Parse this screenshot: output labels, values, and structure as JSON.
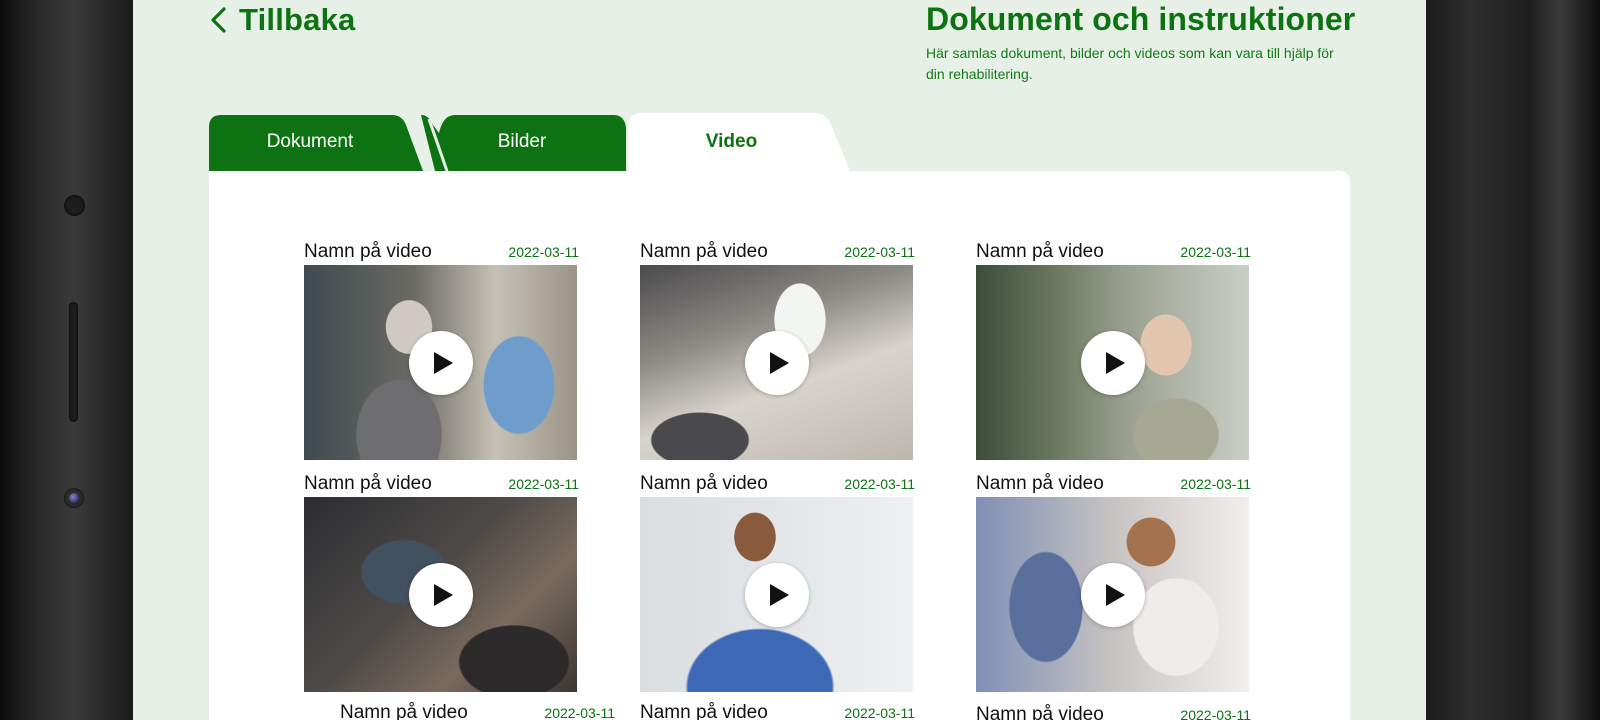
{
  "header": {
    "back_label": "Tillbaka",
    "title": "Dokument och instruktioner",
    "subtitle": "Här samlas dokument, bilder och videos som kan vara till hjälp för din rehabilitering."
  },
  "tabs": [
    {
      "label": "Dokument",
      "active": false
    },
    {
      "label": "Bilder",
      "active": false
    },
    {
      "label": "Video",
      "active": true
    }
  ],
  "videos": [
    {
      "name": "Namn på video",
      "date": "2022-03-11"
    },
    {
      "name": "Namn på video",
      "date": "2022-03-11"
    },
    {
      "name": "Namn på video",
      "date": "2022-03-11"
    },
    {
      "name": "Namn på video",
      "date": "2022-03-11"
    },
    {
      "name": "Namn på video",
      "date": "2022-03-11"
    },
    {
      "name": "Namn på video",
      "date": "2022-03-11"
    },
    {
      "name": "Namn på video",
      "date": "2022-03-11"
    },
    {
      "name": "Namn på video",
      "date": "2022-03-11"
    },
    {
      "name": "Namn på video",
      "date": "2022-03-11"
    }
  ],
  "colors": {
    "brand_green": "#0d7211",
    "screen_background": "#e6f0e6",
    "panel_background": "#ffffff"
  },
  "icons": {
    "back": "chevron-left-icon",
    "play": "play-icon"
  }
}
